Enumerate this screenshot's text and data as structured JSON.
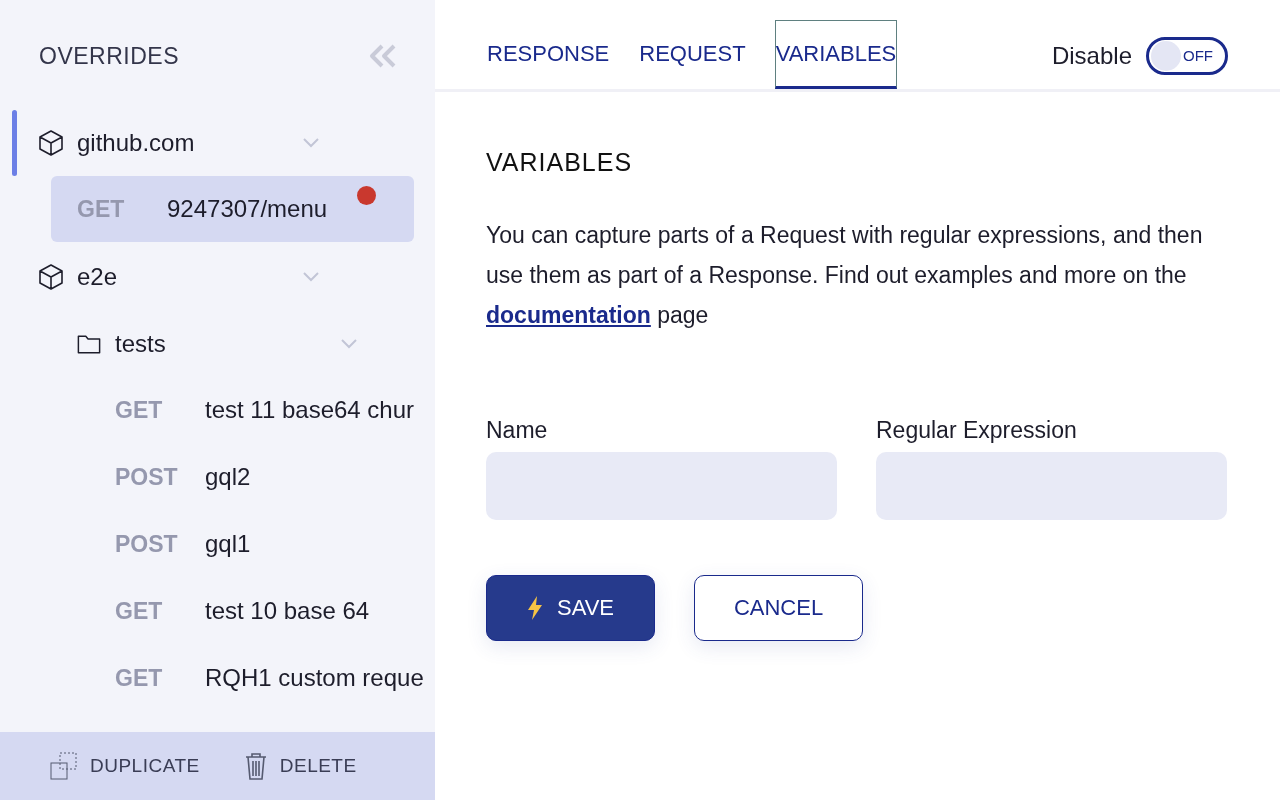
{
  "sidebar": {
    "title": "OVERRIDES",
    "tree": [
      {
        "kind": "group",
        "label": "github.com",
        "expanded": true,
        "selected": true,
        "children": [
          {
            "kind": "request",
            "method": "GET",
            "label": "9247307/menu",
            "selected": true,
            "modified": true
          }
        ]
      },
      {
        "kind": "group",
        "label": "e2e",
        "expanded": true,
        "selected": false,
        "children": [
          {
            "kind": "folder",
            "label": "tests",
            "expanded": true,
            "children": [
              {
                "kind": "request",
                "method": "GET",
                "label": "test 11 base64 chur",
                "selected": false,
                "modified": false
              },
              {
                "kind": "request",
                "method": "POST",
                "label": "gql2",
                "selected": false,
                "modified": false
              },
              {
                "kind": "request",
                "method": "POST",
                "label": "gql1",
                "selected": false,
                "modified": false
              },
              {
                "kind": "request",
                "method": "GET",
                "label": "test 10 base 64",
                "selected": false,
                "modified": false
              },
              {
                "kind": "request",
                "method": "GET",
                "label": "RQH1 custom reque",
                "selected": false,
                "modified": false
              }
            ]
          }
        ]
      }
    ],
    "actions": [
      {
        "kind": "duplicate",
        "label": "DUPLICATE"
      },
      {
        "kind": "delete",
        "label": "DELETE"
      }
    ]
  },
  "tabs": [
    {
      "label": "RESPONSE",
      "selected": false
    },
    {
      "label": "REQUEST",
      "selected": false
    },
    {
      "label": "VARIABLES",
      "selected": true
    }
  ],
  "toggle": {
    "label": "Disable",
    "on": false,
    "text": "OFF"
  },
  "heading": "VARIABLES",
  "description": "You can capture parts of a Request with regular expressions, and then use them as part of a Response. Find out examples and more on the",
  "link": "documentation",
  "description_end": "page",
  "fields": [
    {
      "label": "Name"
    },
    {
      "label": "Regular Expression"
    }
  ],
  "buttons": [
    {
      "kind": "primary",
      "label": "SAVE"
    },
    {
      "kind": "secondary",
      "label": "CANCEL"
    }
  ]
}
